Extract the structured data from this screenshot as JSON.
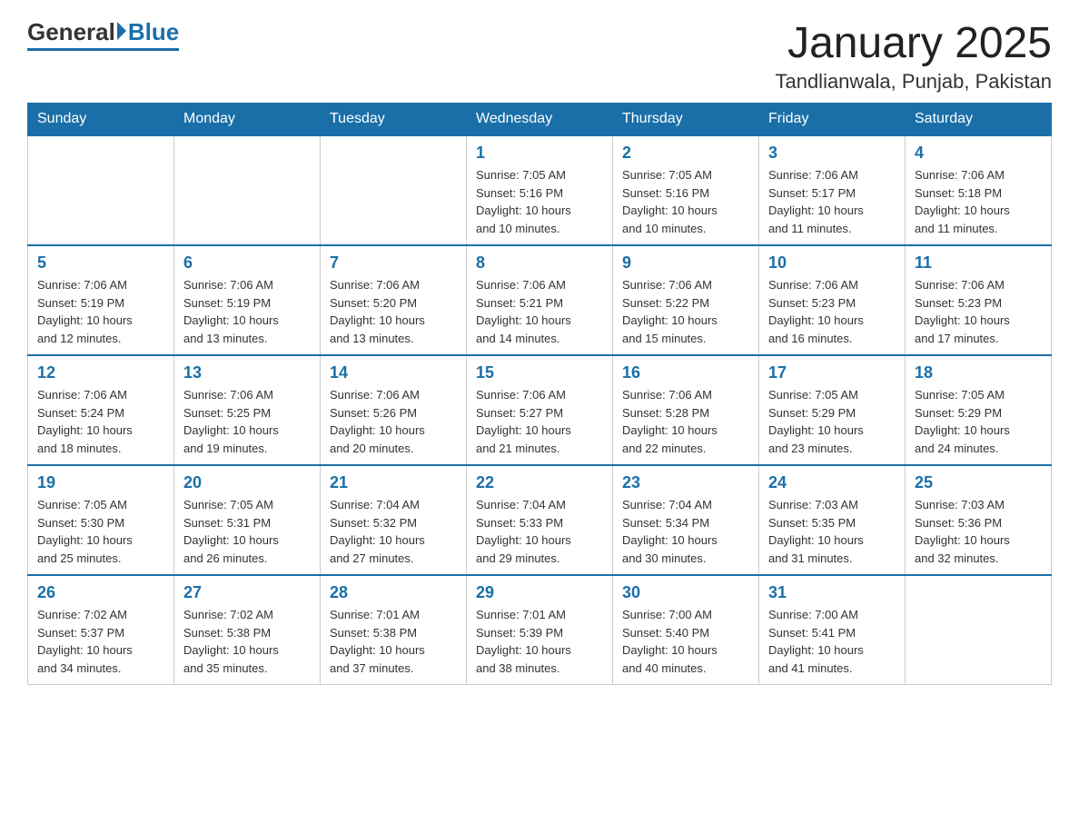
{
  "header": {
    "logo_general": "General",
    "logo_blue": "Blue",
    "title": "January 2025",
    "subtitle": "Tandlianwala, Punjab, Pakistan"
  },
  "days_of_week": [
    "Sunday",
    "Monday",
    "Tuesday",
    "Wednesday",
    "Thursday",
    "Friday",
    "Saturday"
  ],
  "weeks": [
    [
      {
        "day": "",
        "info": ""
      },
      {
        "day": "",
        "info": ""
      },
      {
        "day": "",
        "info": ""
      },
      {
        "day": "1",
        "info": "Sunrise: 7:05 AM\nSunset: 5:16 PM\nDaylight: 10 hours\nand 10 minutes."
      },
      {
        "day": "2",
        "info": "Sunrise: 7:05 AM\nSunset: 5:16 PM\nDaylight: 10 hours\nand 10 minutes."
      },
      {
        "day": "3",
        "info": "Sunrise: 7:06 AM\nSunset: 5:17 PM\nDaylight: 10 hours\nand 11 minutes."
      },
      {
        "day": "4",
        "info": "Sunrise: 7:06 AM\nSunset: 5:18 PM\nDaylight: 10 hours\nand 11 minutes."
      }
    ],
    [
      {
        "day": "5",
        "info": "Sunrise: 7:06 AM\nSunset: 5:19 PM\nDaylight: 10 hours\nand 12 minutes."
      },
      {
        "day": "6",
        "info": "Sunrise: 7:06 AM\nSunset: 5:19 PM\nDaylight: 10 hours\nand 13 minutes."
      },
      {
        "day": "7",
        "info": "Sunrise: 7:06 AM\nSunset: 5:20 PM\nDaylight: 10 hours\nand 13 minutes."
      },
      {
        "day": "8",
        "info": "Sunrise: 7:06 AM\nSunset: 5:21 PM\nDaylight: 10 hours\nand 14 minutes."
      },
      {
        "day": "9",
        "info": "Sunrise: 7:06 AM\nSunset: 5:22 PM\nDaylight: 10 hours\nand 15 minutes."
      },
      {
        "day": "10",
        "info": "Sunrise: 7:06 AM\nSunset: 5:23 PM\nDaylight: 10 hours\nand 16 minutes."
      },
      {
        "day": "11",
        "info": "Sunrise: 7:06 AM\nSunset: 5:23 PM\nDaylight: 10 hours\nand 17 minutes."
      }
    ],
    [
      {
        "day": "12",
        "info": "Sunrise: 7:06 AM\nSunset: 5:24 PM\nDaylight: 10 hours\nand 18 minutes."
      },
      {
        "day": "13",
        "info": "Sunrise: 7:06 AM\nSunset: 5:25 PM\nDaylight: 10 hours\nand 19 minutes."
      },
      {
        "day": "14",
        "info": "Sunrise: 7:06 AM\nSunset: 5:26 PM\nDaylight: 10 hours\nand 20 minutes."
      },
      {
        "day": "15",
        "info": "Sunrise: 7:06 AM\nSunset: 5:27 PM\nDaylight: 10 hours\nand 21 minutes."
      },
      {
        "day": "16",
        "info": "Sunrise: 7:06 AM\nSunset: 5:28 PM\nDaylight: 10 hours\nand 22 minutes."
      },
      {
        "day": "17",
        "info": "Sunrise: 7:05 AM\nSunset: 5:29 PM\nDaylight: 10 hours\nand 23 minutes."
      },
      {
        "day": "18",
        "info": "Sunrise: 7:05 AM\nSunset: 5:29 PM\nDaylight: 10 hours\nand 24 minutes."
      }
    ],
    [
      {
        "day": "19",
        "info": "Sunrise: 7:05 AM\nSunset: 5:30 PM\nDaylight: 10 hours\nand 25 minutes."
      },
      {
        "day": "20",
        "info": "Sunrise: 7:05 AM\nSunset: 5:31 PM\nDaylight: 10 hours\nand 26 minutes."
      },
      {
        "day": "21",
        "info": "Sunrise: 7:04 AM\nSunset: 5:32 PM\nDaylight: 10 hours\nand 27 minutes."
      },
      {
        "day": "22",
        "info": "Sunrise: 7:04 AM\nSunset: 5:33 PM\nDaylight: 10 hours\nand 29 minutes."
      },
      {
        "day": "23",
        "info": "Sunrise: 7:04 AM\nSunset: 5:34 PM\nDaylight: 10 hours\nand 30 minutes."
      },
      {
        "day": "24",
        "info": "Sunrise: 7:03 AM\nSunset: 5:35 PM\nDaylight: 10 hours\nand 31 minutes."
      },
      {
        "day": "25",
        "info": "Sunrise: 7:03 AM\nSunset: 5:36 PM\nDaylight: 10 hours\nand 32 minutes."
      }
    ],
    [
      {
        "day": "26",
        "info": "Sunrise: 7:02 AM\nSunset: 5:37 PM\nDaylight: 10 hours\nand 34 minutes."
      },
      {
        "day": "27",
        "info": "Sunrise: 7:02 AM\nSunset: 5:38 PM\nDaylight: 10 hours\nand 35 minutes."
      },
      {
        "day": "28",
        "info": "Sunrise: 7:01 AM\nSunset: 5:38 PM\nDaylight: 10 hours\nand 37 minutes."
      },
      {
        "day": "29",
        "info": "Sunrise: 7:01 AM\nSunset: 5:39 PM\nDaylight: 10 hours\nand 38 minutes."
      },
      {
        "day": "30",
        "info": "Sunrise: 7:00 AM\nSunset: 5:40 PM\nDaylight: 10 hours\nand 40 minutes."
      },
      {
        "day": "31",
        "info": "Sunrise: 7:00 AM\nSunset: 5:41 PM\nDaylight: 10 hours\nand 41 minutes."
      },
      {
        "day": "",
        "info": ""
      }
    ]
  ]
}
